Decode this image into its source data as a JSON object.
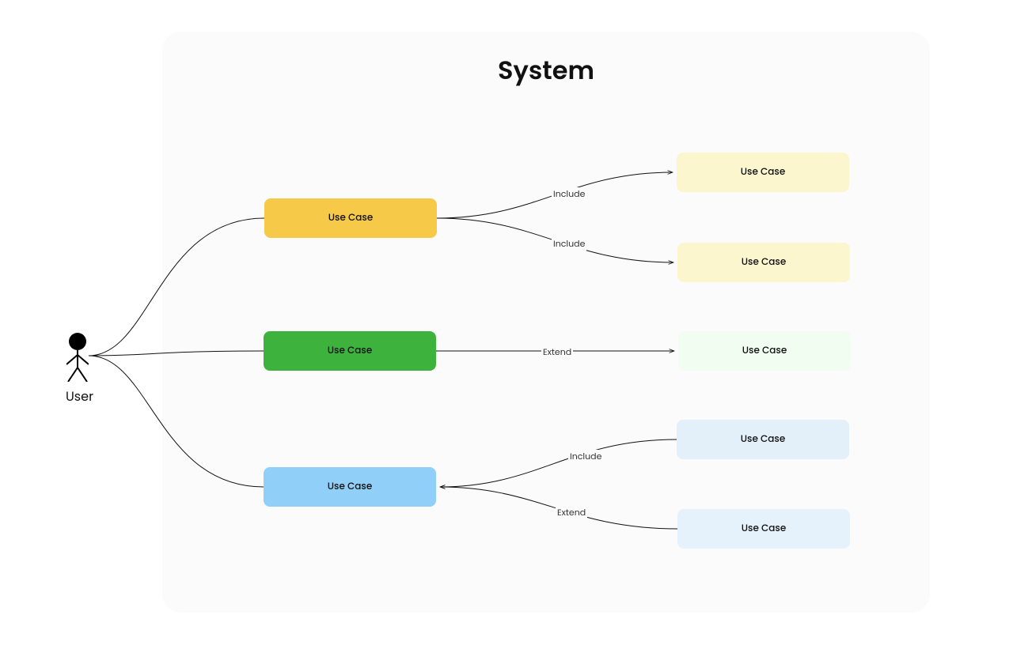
{
  "title": "System",
  "actor": {
    "label": "User"
  },
  "nodes": {
    "yellow": {
      "label": "Use Case",
      "fill": "#F7C948"
    },
    "green": {
      "label": "Use Case",
      "fill": "#3DB33D"
    },
    "blue": {
      "label": "Use Case",
      "fill": "#8FCFF8"
    },
    "yellow_light1": {
      "label": "Use Case",
      "fill": "#FCF6CF"
    },
    "yellow_light2": {
      "label": "Use Case",
      "fill": "#FCF6CF"
    },
    "green_light": {
      "label": "Use Case",
      "fill": "#F1FDF1"
    },
    "blue_light1": {
      "label": "Use Case",
      "fill": "#E3F0FA"
    },
    "blue_light2": {
      "label": "Use Case",
      "fill": "#E6F2FB"
    }
  },
  "edges": {
    "yellow_to_yl1": {
      "label": "Include"
    },
    "yellow_to_yl2": {
      "label": "Include"
    },
    "green_to_gl": {
      "label": "Extend"
    },
    "bl1_to_blue": {
      "label": "Include"
    },
    "bl2_to_blue": {
      "label": "Extend"
    }
  }
}
